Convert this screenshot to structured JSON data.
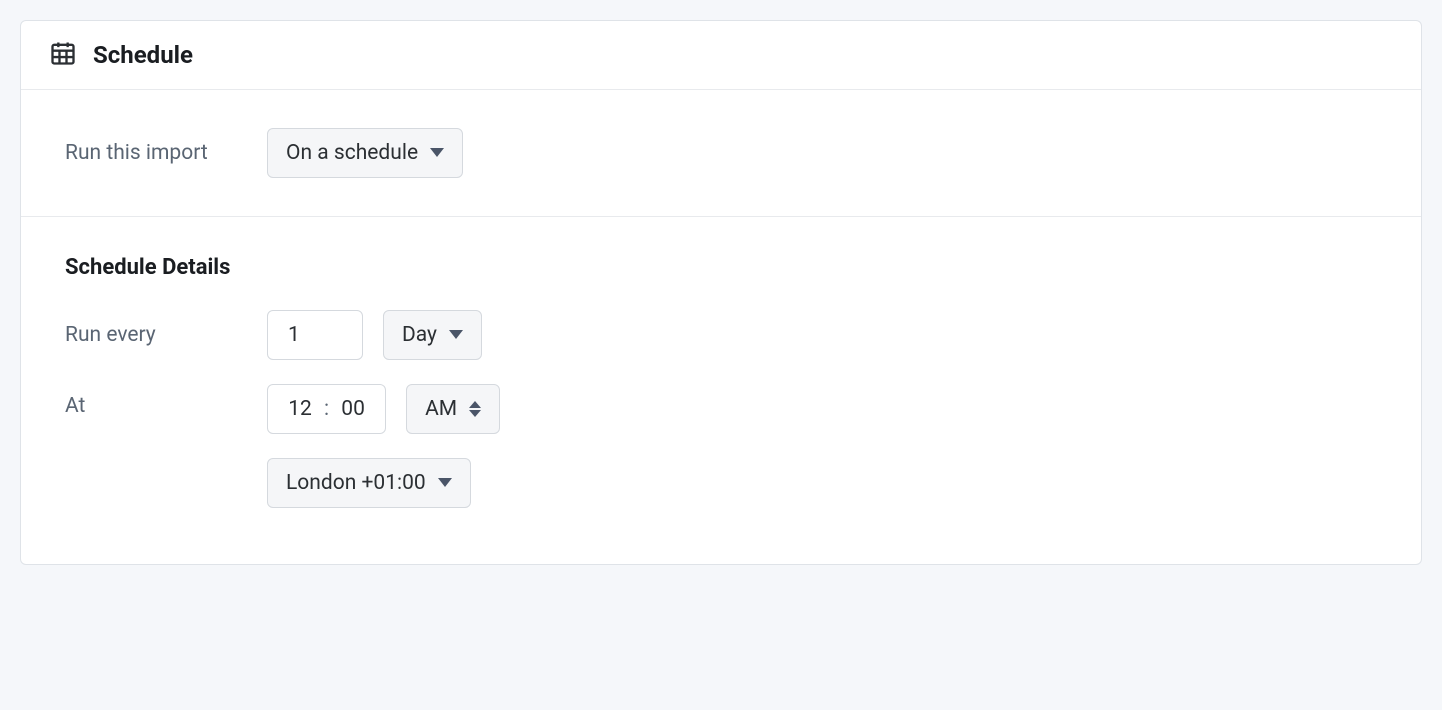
{
  "card": {
    "title": "Schedule"
  },
  "runImport": {
    "label": "Run this import",
    "selected": "On a schedule"
  },
  "details": {
    "heading": "Schedule Details",
    "runEvery": {
      "label": "Run every",
      "count": "1",
      "unit": "Day"
    },
    "at": {
      "label": "At",
      "hour": "12",
      "minute": "00",
      "meridiem": "AM",
      "timezone": "London +01:00"
    }
  }
}
